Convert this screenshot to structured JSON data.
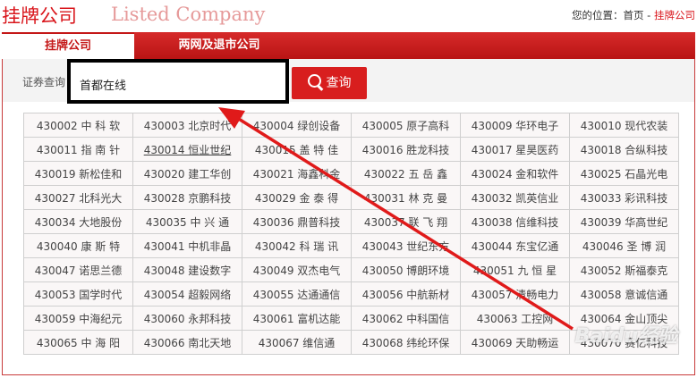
{
  "header": {
    "title": "挂牌公司",
    "subtitle": "Listed Company",
    "location_label": "您的位置：",
    "crumb_home": "首页",
    "crumb_sep": " - ",
    "crumb_current": "挂牌公司"
  },
  "tabs": [
    {
      "label": "挂牌公司",
      "active": true
    },
    {
      "label": "两网及退市公司",
      "active": false
    }
  ],
  "search": {
    "label": "证券查询",
    "value": "首都在线",
    "button_label": "查询"
  },
  "companies": [
    [
      "430002 中 科 软",
      "430003 北京时代",
      "430004 绿创设备",
      "430005 原子高科",
      "430009 华环电子",
      "430010 现代农装"
    ],
    [
      "430011 指 南 针",
      "430014 恒业世纪",
      "430015 盖 特 佳",
      "430016 胜龙科技",
      "430017 星昊医药",
      "430018 合纵科技"
    ],
    [
      "430019 新松佳和",
      "430020 建工华创",
      "430021 海鑫科金",
      "430022 五 岳 鑫",
      "430024 金和软件",
      "430025 石晶光电"
    ],
    [
      "430027 北科光大",
      "430028 京鹏科技",
      "430029 金 泰 得",
      "430031 林 克 曼",
      "430032 凯英信业",
      "430033 彩讯科技"
    ],
    [
      "430034 大地股份",
      "430035 中 兴 通",
      "430036 鼎普科技",
      "430037 联 飞 翔",
      "430038 信维科技",
      "430039 华高世纪"
    ],
    [
      "430040 康 斯 特",
      "430041 中机非晶",
      "430042 科 瑞 讯",
      "430043 世纪东方",
      "430044 东宝亿通",
      "430046 圣 博 润"
    ],
    [
      "430047 诺思兰德",
      "430048 建设数字",
      "430049 双杰电气",
      "430050 博朗环境",
      "430051 九 恒 星",
      "430052 斯福泰克"
    ],
    [
      "430053 国学时代",
      "430054 超毅网络",
      "430055 达通通信",
      "430056 中航新材",
      "430057 清畅电力",
      "430058 意诚信通"
    ],
    [
      "430059 中海纪元",
      "430060 永邦科技",
      "430061 富机达能",
      "430062 中科国信",
      "430063 工控网",
      "430064 金山顶尖"
    ],
    [
      "430065 中 海 阳",
      "430066 南北天地",
      "430067 维信通",
      "430068 纬纶环保",
      "430069 天助畅运",
      "430070 赛亿科技"
    ]
  ],
  "hovered_cell": "430014 恒业世纪",
  "watermark": "Baidu经验",
  "colors": {
    "brand_red": "#d9151b",
    "annotation_red": "#e01a1a"
  }
}
